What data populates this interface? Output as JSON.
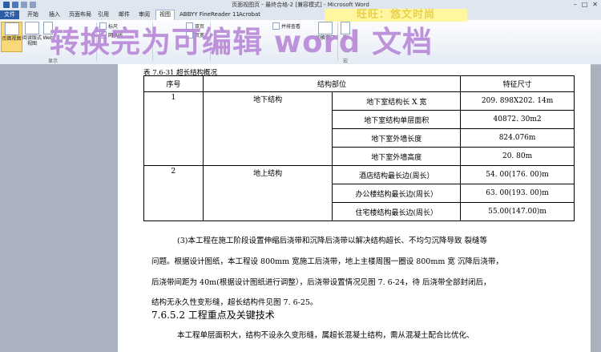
{
  "window": {
    "title": "页面视图页 - 最终合格-2 [兼容模式] - Microsoft Word"
  },
  "tabs": [
    "文件",
    "开始",
    "插入",
    "页面布局",
    "引用",
    "邮件",
    "审阅",
    "视图",
    "ABBYY FineReader 11",
    "Acrobat"
  ],
  "ribbon": {
    "page_view": "页面视图",
    "reading_view": "阅读版式视图",
    "web_view": "Web",
    "ruler": "标尺",
    "gridlines": "网格线",
    "zoom_group": "显示",
    "two_page": "双页",
    "page_width": "页宽",
    "side_by_side": "并排查看",
    "switch_window": "切换窗口",
    "macro": "宏",
    "macro_group": "宏"
  },
  "banner_top": "旺旺：悠文时尚",
  "watermark": "转换完为可编辑  word  文档",
  "document": {
    "caption": "表 7.6-31 超长结构概况",
    "table": {
      "headers": [
        "序号",
        "结构部位",
        "特征尺寸"
      ],
      "groups": [
        {
          "no": "1",
          "part": "地下结构",
          "rows": [
            {
              "item": "地下室结构长 X 宽",
              "value": "209. 898X202. 14m"
            },
            {
              "item": "地下室结构单层面积",
              "value": "40872. 30m2"
            },
            {
              "item": "地下室外墙长度",
              "value": "824.076m"
            },
            {
              "item": "地下室外墙高度",
              "value": "20. 80m"
            }
          ]
        },
        {
          "no": "2",
          "part": "地上结构",
          "rows": [
            {
              "item": "酒店结构最长边(周长）",
              "value": "54. 00(176. 00)m"
            },
            {
              "item": "办公楼结构最长边(周长）",
              "value": "63. 00(193. 00)m"
            },
            {
              "item": "住宅楼结构最长边(周长）",
              "value": "55.00(147.00)m"
            }
          ]
        }
      ]
    },
    "para1": [
      "(3)本工程在施工阶段设置伸缩后浇带和沉降后浇带以解决结构超长、不均匀沉降导致  裂缝等",
      "问题。根据设计图纸，本工程设 800mm 宽施工后浇带，地上主楼周围一圈设 800mm 宽  沉降后浇带，",
      "后浇带间距为 40m(根据设计图纸进行调整），后浇带设置情况见图 7. 6-24，待 后浇带全部封闭后，",
      "结构无永久性变形缝，超长结构件见图 7.  6-25。"
    ],
    "heading": "7.6.5.2 工程重点及关键技术",
    "para2": "本工程单层面积大，结构不设永久变形缝，属超长混凝土结构，需从混凝土配合比优化、"
  }
}
